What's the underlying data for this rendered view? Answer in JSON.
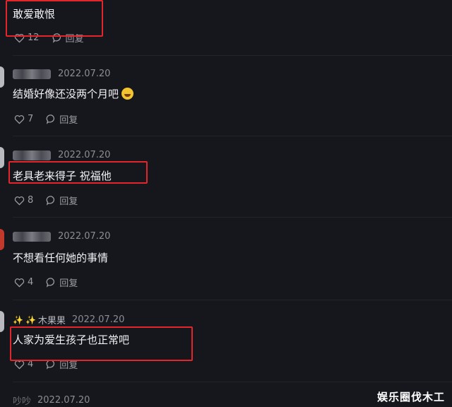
{
  "comments": [
    {
      "text": "敢爱敢恨",
      "likes": "12",
      "reply_label": "回复"
    },
    {
      "date": "2022.07.20",
      "text": "结婚好像还没两个月吧",
      "likes": "7",
      "reply_label": "回复"
    },
    {
      "date": "2022.07.20",
      "text": "老具老来得子 祝福他",
      "likes": "8",
      "reply_label": "回复"
    },
    {
      "date": "2022.07.20",
      "text": "不想看任何她的事情",
      "likes": "4",
      "reply_label": "回复"
    },
    {
      "username": "木果果",
      "date": "2022.07.20",
      "text": "人家为爱生孩子也正常吧",
      "likes": "4",
      "reply_label": "回复"
    },
    {
      "username": "吵吵",
      "date": "2022.07.20"
    }
  ],
  "watermark": "娱乐圈伐木工",
  "colors": {
    "background": "#16171c",
    "highlight_box": "#e3262b",
    "meta": "#8c8d96"
  }
}
